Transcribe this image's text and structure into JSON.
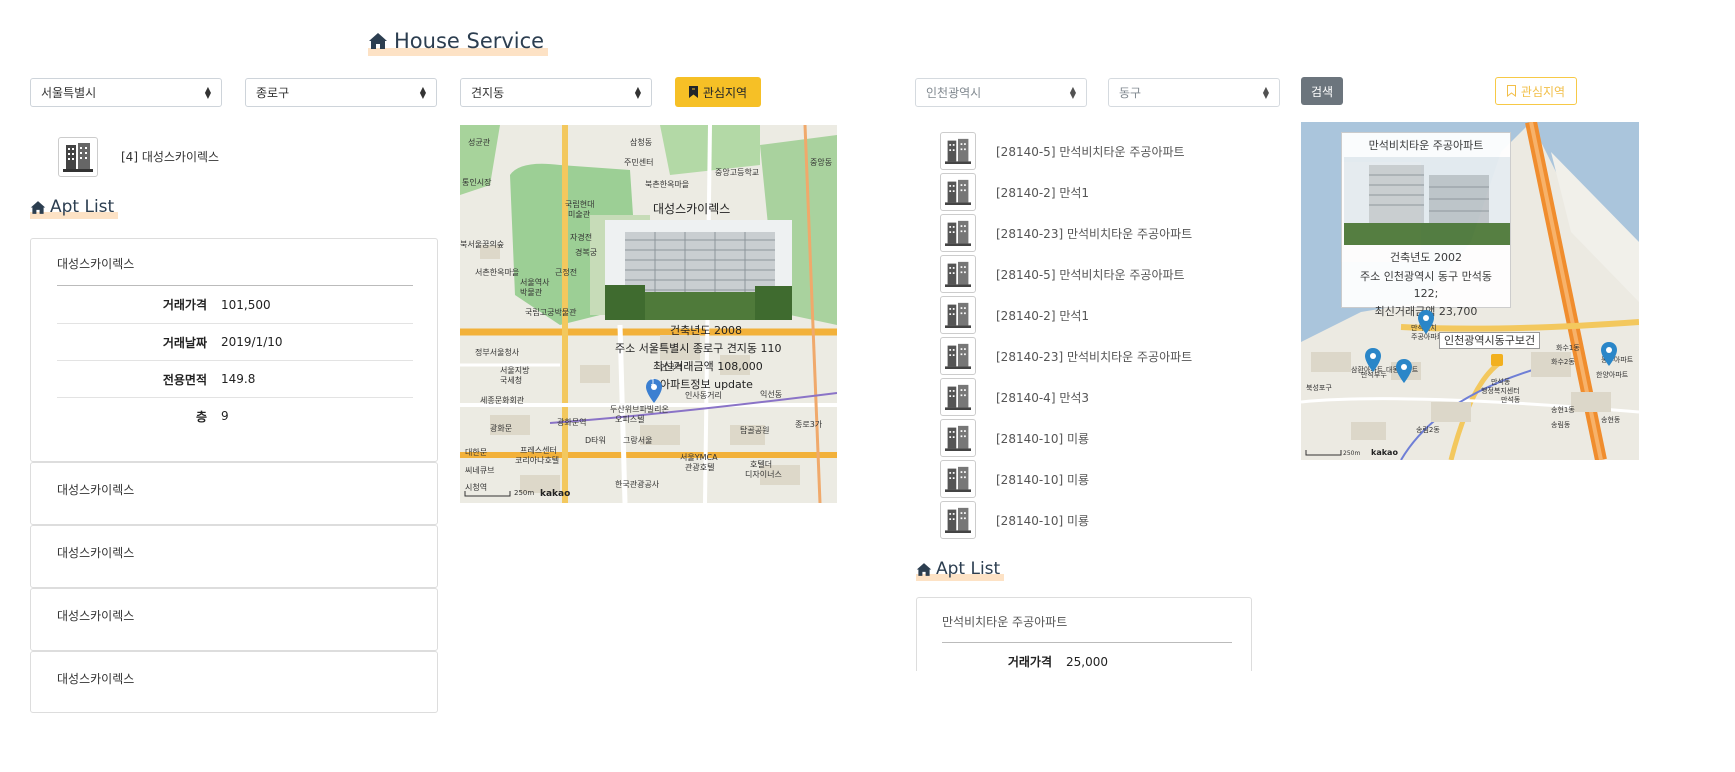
{
  "header": {
    "title": "House Service"
  },
  "left": {
    "filters": {
      "city": "서울특별시",
      "district": "종로구",
      "dong": "견지동",
      "interest_button": "관심지역"
    },
    "search_result": {
      "label": "[4] 대성스카이렉스"
    },
    "apt_list_title": "Apt List",
    "detail": {
      "name": "대성스카이렉스",
      "rows": [
        {
          "key": "거래가격",
          "value": "101,500"
        },
        {
          "key": "거래날짜",
          "value": "2019/1/10"
        },
        {
          "key": "전용면적",
          "value": "149.8"
        },
        {
          "key": "층",
          "value": "9"
        }
      ]
    },
    "collapsed_items": [
      "대성스카이렉스",
      "대성스카이렉스",
      "대성스카이렉스",
      "대성스카이렉스"
    ],
    "map": {
      "overlay_title": "대성스카이렉스",
      "info_lines": [
        "건축년도 2008",
        "주소 서울특별시 종로구 견지동 110",
        "최신거래금액 108,000",
        "아파트정보 update"
      ],
      "marker_label": "1",
      "labels": [
        "성균관",
        "삼청동",
        "주민센터",
        "북촌한옥마을",
        "중앙고등학교",
        "국립현대",
        "미술관",
        "서울역사",
        "박물관",
        "정부서울청사",
        "세종문화회관",
        "광화문역",
        "광화문",
        "두산위브파빌리온",
        "오피스텔",
        "인사동거리",
        "익선동",
        "탑골공원",
        "종로3가",
        "D타워",
        "그랑서울",
        "서울YMCA",
        "관광호텔",
        "호텔더",
        "디자이너스",
        "한국관광공사",
        "프레스센터",
        "코리아나호텔",
        "대한문",
        "시청역",
        "씨네큐브",
        "서울지방",
        "국세청",
        "안국역",
        "북서울꿈의숲",
        "서촌한옥마을",
        "근정전",
        "자경전",
        "경복궁",
        "통인시장",
        "국립고궁박물관",
        "중앙동"
      ],
      "scale": "250m",
      "logo": "kakao"
    }
  },
  "right": {
    "filters": {
      "city": "인천광역시",
      "district": "동구",
      "search_button": "검색",
      "interest_button": "관심지역"
    },
    "list": [
      "[28140-5] 만석비치타운 주공아파트",
      "[28140-2] 만석1",
      "[28140-23] 만석비치타운 주공아파트",
      "[28140-5] 만석비치타운 주공아파트",
      "[28140-2] 만석1",
      "[28140-23] 만석비치타운 주공아파트",
      "[28140-4] 만석3",
      "[28140-10] 미룡",
      "[28140-10] 미룡",
      "[28140-10] 미룡"
    ],
    "apt_list_title": "Apt List",
    "detail": {
      "name": "만석비치타운 주공아파트",
      "rows": [
        {
          "key": "거래가격",
          "value": "25,000"
        }
      ]
    },
    "map": {
      "overlay_title": "만석비치타운 주공아파트",
      "info_lines": [
        "건축년도 2002",
        "주소 인천광역시 동구 만석동",
        "122;",
        "최신거래금액 23,700"
      ],
      "tooltip": "인천광역시동구보건",
      "labels": [
        "만석비치",
        "주공아파트",
        "만석부두",
        "만석동",
        "행정복지센터",
        "화수2동",
        "화수1동",
        "송현1동",
        "송림2동",
        "북성포구",
        "동부아파트",
        "만석동",
        "송현동",
        "삼환아파트",
        "송림동",
        "한양아파트",
        "대동아파트"
      ],
      "scale": "250m",
      "logo": "kakao"
    }
  }
}
